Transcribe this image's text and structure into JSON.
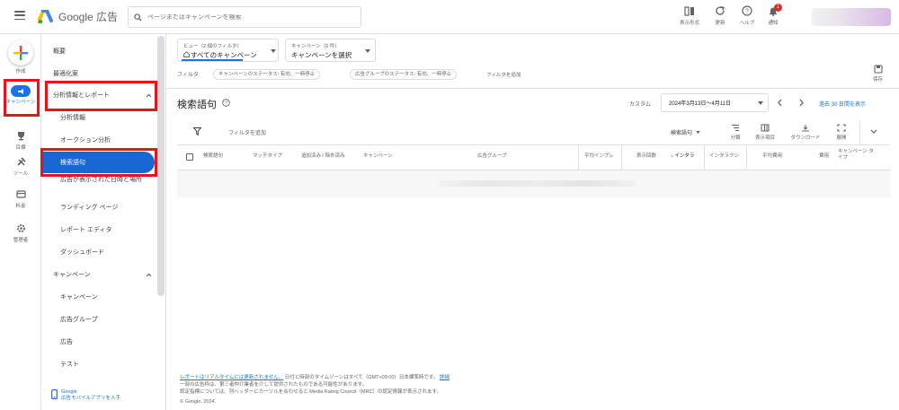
{
  "header": {
    "app_name": "Google 広告",
    "search_placeholder": "ページまたはキャンペーンを検索",
    "icons": [
      {
        "name": "appearance",
        "label": "表示形式"
      },
      {
        "name": "refresh",
        "label": "更新"
      },
      {
        "name": "help",
        "label": "ヘルプ"
      },
      {
        "name": "notifications",
        "label": "通知",
        "badge": "1"
      }
    ]
  },
  "rail": {
    "items": [
      {
        "label": "作成"
      },
      {
        "label": "キャンペーン"
      },
      {
        "label": "目標"
      },
      {
        "label": "ツール"
      },
      {
        "label": "料金"
      },
      {
        "label": "管理者"
      }
    ]
  },
  "nav": {
    "items": [
      {
        "label": "概要"
      },
      {
        "label": "最適化案"
      },
      {
        "label": "分析情報とレポート"
      },
      {
        "label": "分析情報"
      },
      {
        "label": "オークション分析"
      },
      {
        "label": "検索語句"
      },
      {
        "label": "広告が表示された日時と場所"
      },
      {
        "label": "ランディング ページ"
      },
      {
        "label": "レポート エディタ"
      },
      {
        "label": "ダッシュボード"
      },
      {
        "label": "キャンペーン"
      },
      {
        "label": "キャンペーン"
      },
      {
        "label": "広告グループ"
      },
      {
        "label": "広告"
      },
      {
        "label": "テスト"
      }
    ],
    "app_promo_line1": "Google",
    "app_promo_line2": "広告モバイルアプリを入手"
  },
  "main": {
    "view_small": "ビュー（2 個のフィルタ）",
    "view_value": "すべてのキャンペーン",
    "campaign_small": "キャンペーン（6 件）",
    "campaign_value": "キャンペーンを選択",
    "filter_label": "フィルタ",
    "filter_chips": [
      "キャンペーンのステータス: 有効、一時停止",
      "広告グループのステータス: 有効、一時停止"
    ],
    "add_filter": "フィルタを追加",
    "save_label": "保存",
    "page_title": "検索語句",
    "date_label": "カスタム",
    "date_range": "2024年3月13日～4月11日",
    "last30": "過去 30 日間を表示",
    "add_filter_table": "フィルタを追加",
    "search_terms_dropdown": "検索語句",
    "toolbar": [
      "分類",
      "表示項目",
      "ダウンロード",
      "展開"
    ],
    "columns": [
      "検索語句",
      "マッチタイプ",
      "追加済み / 除外済み",
      "キャンペーン",
      "広告グループ",
      "平均インプレ",
      "表示回数",
      "インタラ",
      "インタラクシ",
      "平均費用",
      "費用",
      "キャンペーン タイプ"
    ],
    "footer": {
      "line1_link": "レポートはリアルタイムには更新されません。",
      "line1_rest": " 日付と時刻のタイムゾーンはすべて（GMT+09:00）日本標準時です。",
      "line1_link2": "詳細",
      "line2": "一部の広告枠は、第三者仲介業者を介して提供されたものである可能性があります。",
      "line3": "認定指標については、列ヘッダーにカーソルを合わせると Media Rating Council（MRC）の認定情報が表示されます。",
      "line4": "© Google, 2024."
    }
  },
  "colors": {
    "accent": "#1a73e8",
    "highlight_red": "#e8141a",
    "selected_nav": "#1967d2"
  }
}
